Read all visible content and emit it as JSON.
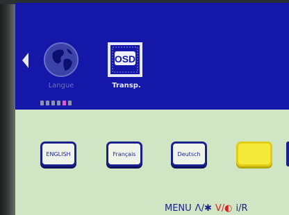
{
  "menu": {
    "items": [
      {
        "label": "Langue",
        "icon": "globe-icon",
        "selected": false
      },
      {
        "label": "Transp.",
        "icon": "osd-icon",
        "icon_text": "OSD",
        "selected": true
      }
    ],
    "page_indicator": {
      "total": 6,
      "active_index": 4
    }
  },
  "languages": {
    "options": [
      "ENGLISH",
      "Français",
      "Deutsch",
      ""
    ],
    "selected_index": 3
  },
  "hints": {
    "menu": "MENU",
    "up": "Λ/✱",
    "down": "V/◐",
    "info": "i/R"
  },
  "colors": {
    "top_panel": "#1417a8",
    "bottom_panel": "#cfe5c3",
    "button_border": "#1a1f8e",
    "selected_button": "#f4ea3a",
    "active_dot": "#d95bd4"
  }
}
